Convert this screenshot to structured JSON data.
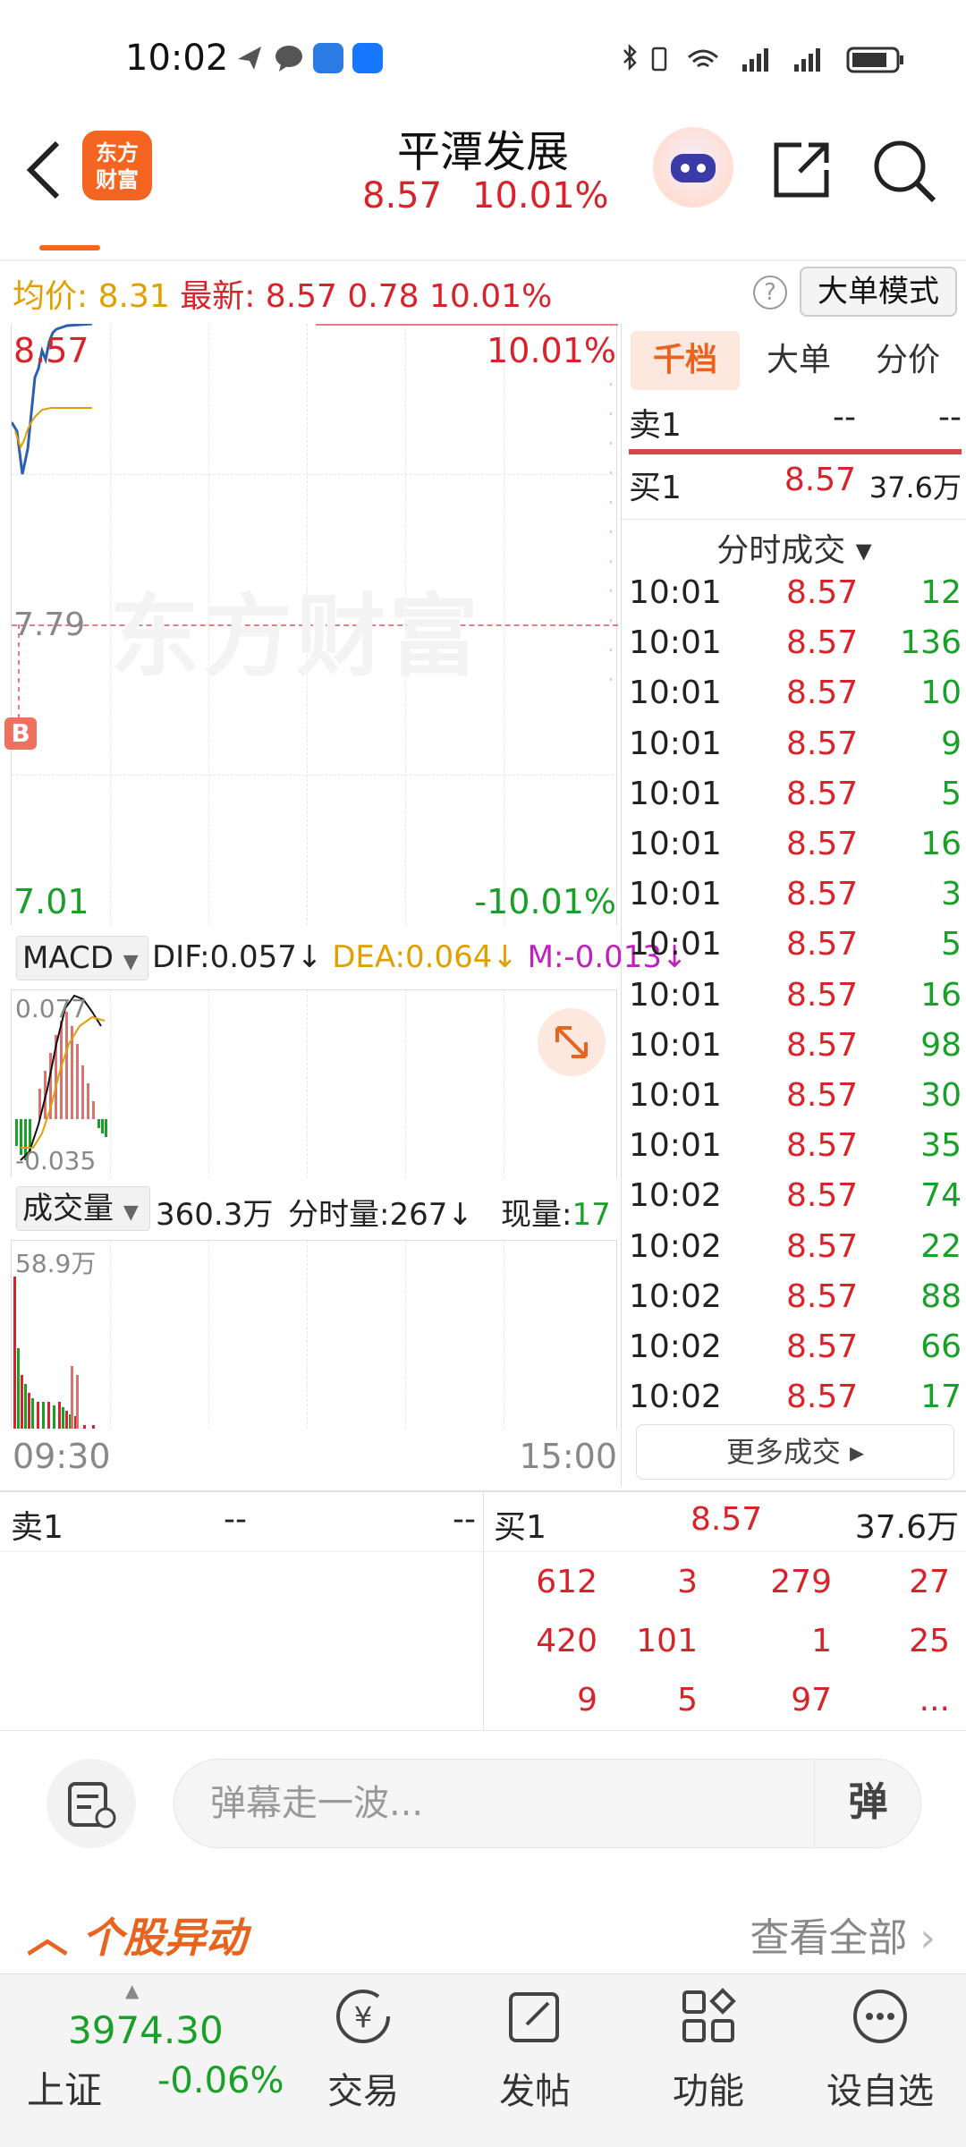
{
  "status_bar": {
    "time": "10:02"
  },
  "header": {
    "logo_text_1": "东方",
    "logo_text_2": "财富",
    "stock_name": "平潭发展",
    "price": "8.57",
    "change_pct": "10.01%"
  },
  "quote_line": {
    "avg_label": "均价:",
    "avg_value": "8.31",
    "latest_label": "最新:",
    "latest_value": "8.57",
    "change": "0.78",
    "change_pct": "10.01%",
    "help": "?",
    "big_order_mode": "大单模式"
  },
  "chart": {
    "high_price": "8.57",
    "high_pct": "10.01%",
    "ref_price": "7.79",
    "low_price": "7.01",
    "low_pct": "-10.01%",
    "watermark": "东方财富",
    "b_marker": "B",
    "time_start": "09:30",
    "time_end": "15:00"
  },
  "macd": {
    "select_label": "MACD",
    "dif": "DIF:0.057↓",
    "dea": "DEA:0.064↓",
    "m": "M:-0.013↓",
    "max_label": "0.077",
    "min_label": "-0.035"
  },
  "volume": {
    "select_label": "成交量",
    "total": "360.3万",
    "minute": "分时量:267↓",
    "now_label": "现量:",
    "now_value": "17",
    "max_label": "58.9万"
  },
  "right_panel": {
    "tabs": [
      "千档",
      "大单",
      "分价"
    ],
    "sell1": {
      "label": "卖1",
      "price": "--",
      "volume": "--"
    },
    "buy1": {
      "label": "买1",
      "price": "8.57",
      "volume": "37.6万"
    },
    "ticks_header": "分时成交 ▾",
    "ticks": [
      {
        "time": "10:01",
        "price": "8.57",
        "vol": "12"
      },
      {
        "time": "10:01",
        "price": "8.57",
        "vol": "136"
      },
      {
        "time": "10:01",
        "price": "8.57",
        "vol": "10"
      },
      {
        "time": "10:01",
        "price": "8.57",
        "vol": "9"
      },
      {
        "time": "10:01",
        "price": "8.57",
        "vol": "5"
      },
      {
        "time": "10:01",
        "price": "8.57",
        "vol": "16"
      },
      {
        "time": "10:01",
        "price": "8.57",
        "vol": "3"
      },
      {
        "time": "10:01",
        "price": "8.57",
        "vol": "5"
      },
      {
        "time": "10:01",
        "price": "8.57",
        "vol": "16"
      },
      {
        "time": "10:01",
        "price": "8.57",
        "vol": "98"
      },
      {
        "time": "10:01",
        "price": "8.57",
        "vol": "30"
      },
      {
        "time": "10:01",
        "price": "8.57",
        "vol": "35"
      },
      {
        "time": "10:02",
        "price": "8.57",
        "vol": "74"
      },
      {
        "time": "10:02",
        "price": "8.57",
        "vol": "22"
      },
      {
        "time": "10:02",
        "price": "8.57",
        "vol": "88"
      },
      {
        "time": "10:02",
        "price": "8.57",
        "vol": "66"
      },
      {
        "time": "10:02",
        "price": "8.57",
        "vol": "17"
      }
    ],
    "more_ticks": "更多成交 ▸"
  },
  "order_book": {
    "sell1": {
      "label": "卖1",
      "price": "--",
      "volume": "--"
    },
    "buy1": {
      "label": "买1",
      "price": "8.57",
      "volume": "37.6万"
    },
    "queue": [
      [
        "612",
        "3",
        "279",
        "27"
      ],
      [
        "420",
        "101",
        "1",
        "25"
      ],
      [
        "9",
        "5",
        "97",
        "..."
      ]
    ]
  },
  "comment": {
    "placeholder": "弹幕走一波...",
    "danmaku_button": "弹"
  },
  "movement": {
    "title": "个股异动",
    "view_all": "查看全部"
  },
  "bottom_nav": {
    "index_value": "3974.30",
    "index_name": "上证",
    "index_change": "-0.06%",
    "items": [
      "交易",
      "发帖",
      "功能",
      "设自选"
    ]
  }
}
